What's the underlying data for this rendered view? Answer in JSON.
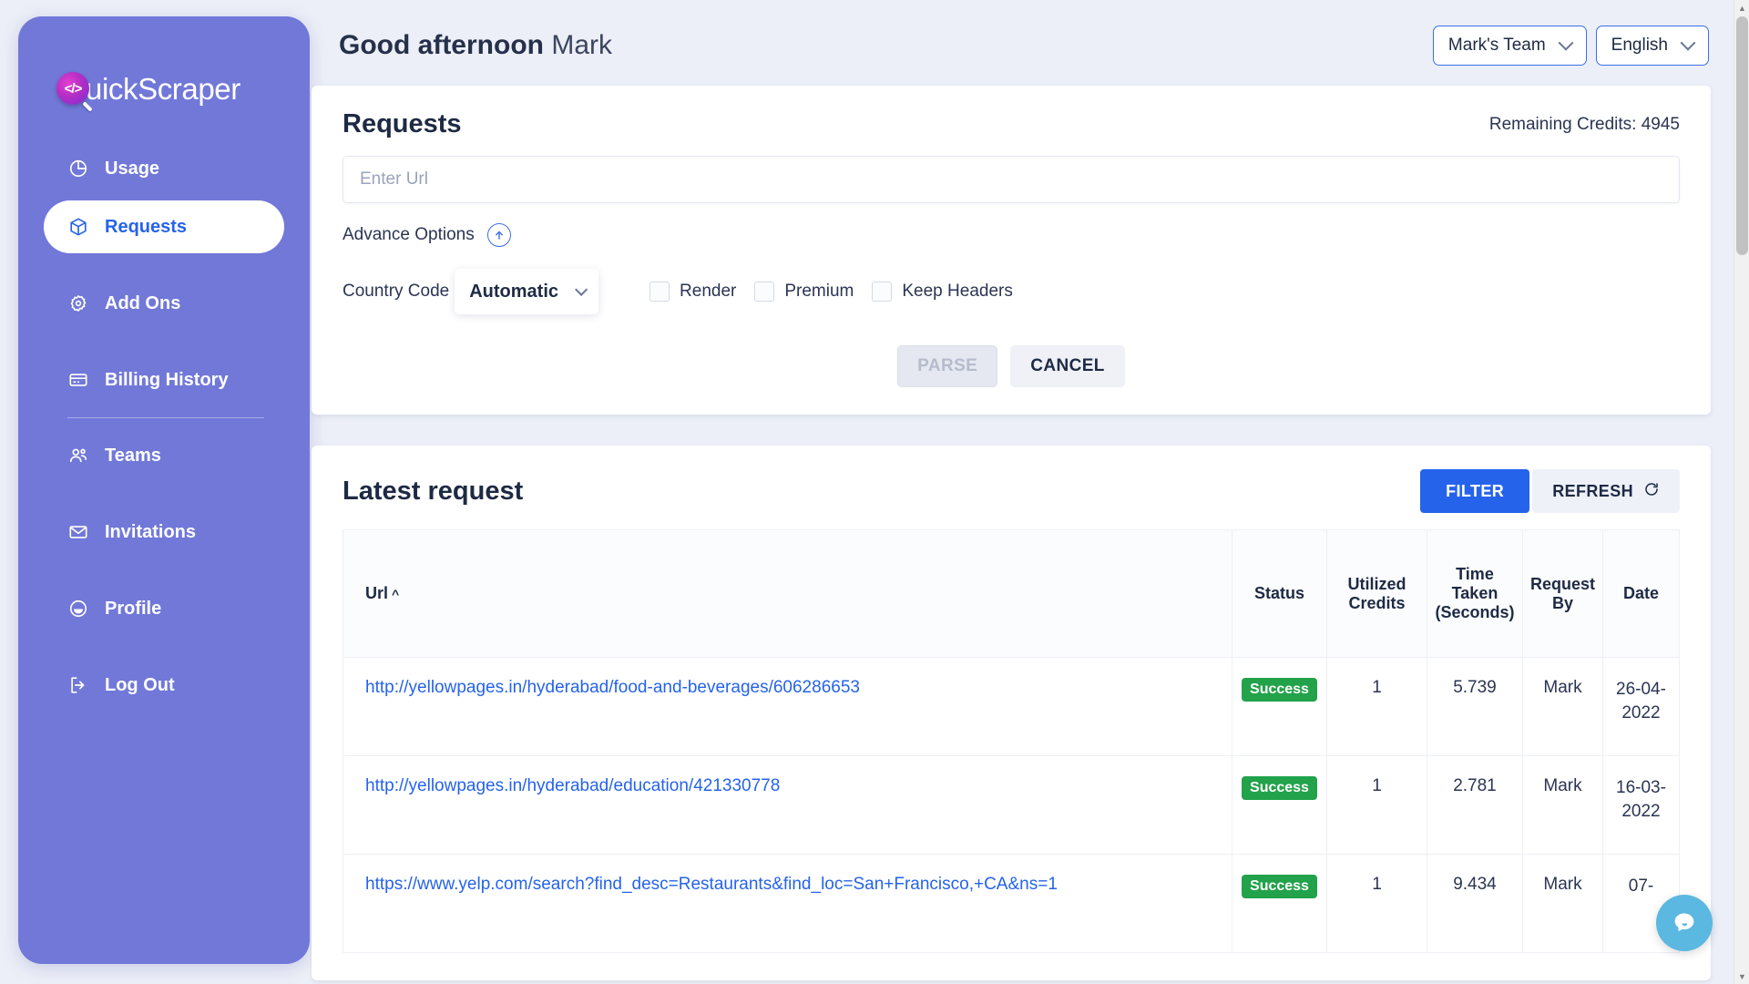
{
  "brand": {
    "logo_glyph": "</>",
    "name": "uickScraper",
    "full_name": "QuickScraper"
  },
  "sidebar": {
    "items": [
      {
        "label": "Usage",
        "icon": "pie-chart-icon",
        "active": false
      },
      {
        "label": "Requests",
        "icon": "cube-icon",
        "active": true
      },
      {
        "label": "Add Ons",
        "icon": "gear-icon",
        "active": false
      },
      {
        "label": "Billing History",
        "icon": "credit-card-icon",
        "active": false
      },
      {
        "label": "Teams",
        "icon": "users-icon",
        "active": false
      },
      {
        "label": "Invitations",
        "icon": "envelope-icon",
        "active": false
      },
      {
        "label": "Profile",
        "icon": "user-circle-icon",
        "active": false
      },
      {
        "label": "Log Out",
        "icon": "logout-icon",
        "active": false
      }
    ]
  },
  "topbar": {
    "greeting_bold": "Good afternoon",
    "greeting_name": "Mark",
    "team_label": "Mark's Team",
    "language_label": "English"
  },
  "requests_card": {
    "title": "Requests",
    "credits_text": "Remaining Credits: 4945",
    "url_placeholder": "Enter Url",
    "url_value": "",
    "advance_options_label": "Advance Options",
    "country_code_label": "Country Code",
    "country_code_value": "Automatic",
    "checkboxes": [
      {
        "label": "Render",
        "checked": false
      },
      {
        "label": "Premium",
        "checked": false
      },
      {
        "label": "Keep Headers",
        "checked": false
      }
    ],
    "parse_label": "PARSE",
    "cancel_label": "CANCEL"
  },
  "latest_card": {
    "title": "Latest request",
    "filter_label": "FILTER",
    "refresh_label": "REFRESH",
    "columns": {
      "url": "Url",
      "url_sort": "^",
      "status": "Status",
      "utilized_credits": "Utilized Credits",
      "time_taken": "Time Taken (Seconds)",
      "requested_by": "Request By",
      "date": "Date"
    },
    "rows": [
      {
        "url": "http://yellowpages.in/hyderabad/food-and-beverages/606286653",
        "status": "Success",
        "credits": "1",
        "time": "5.739",
        "by": "Mark",
        "date": "26-04-2022"
      },
      {
        "url": "http://yellowpages.in/hyderabad/education/421330778",
        "status": "Success",
        "credits": "1",
        "time": "2.781",
        "by": "Mark",
        "date": "16-03-2022"
      },
      {
        "url": "https://www.yelp.com/search?find_desc=Restaurants&find_loc=San+Francisco,+CA&ns=1",
        "status": "Success",
        "credits": "1",
        "time": "9.434",
        "by": "Mark",
        "date": "07-"
      }
    ]
  },
  "colors": {
    "sidebar": "#7178d8",
    "accent_blue": "#2563eb",
    "success_green": "#22a24a",
    "chat_blue": "#5bb8e0",
    "page_bg": "#eceff7"
  },
  "chat": {
    "icon": "chat-bubble-icon"
  },
  "scrollbar": {
    "up": "▲",
    "down": "▼"
  }
}
